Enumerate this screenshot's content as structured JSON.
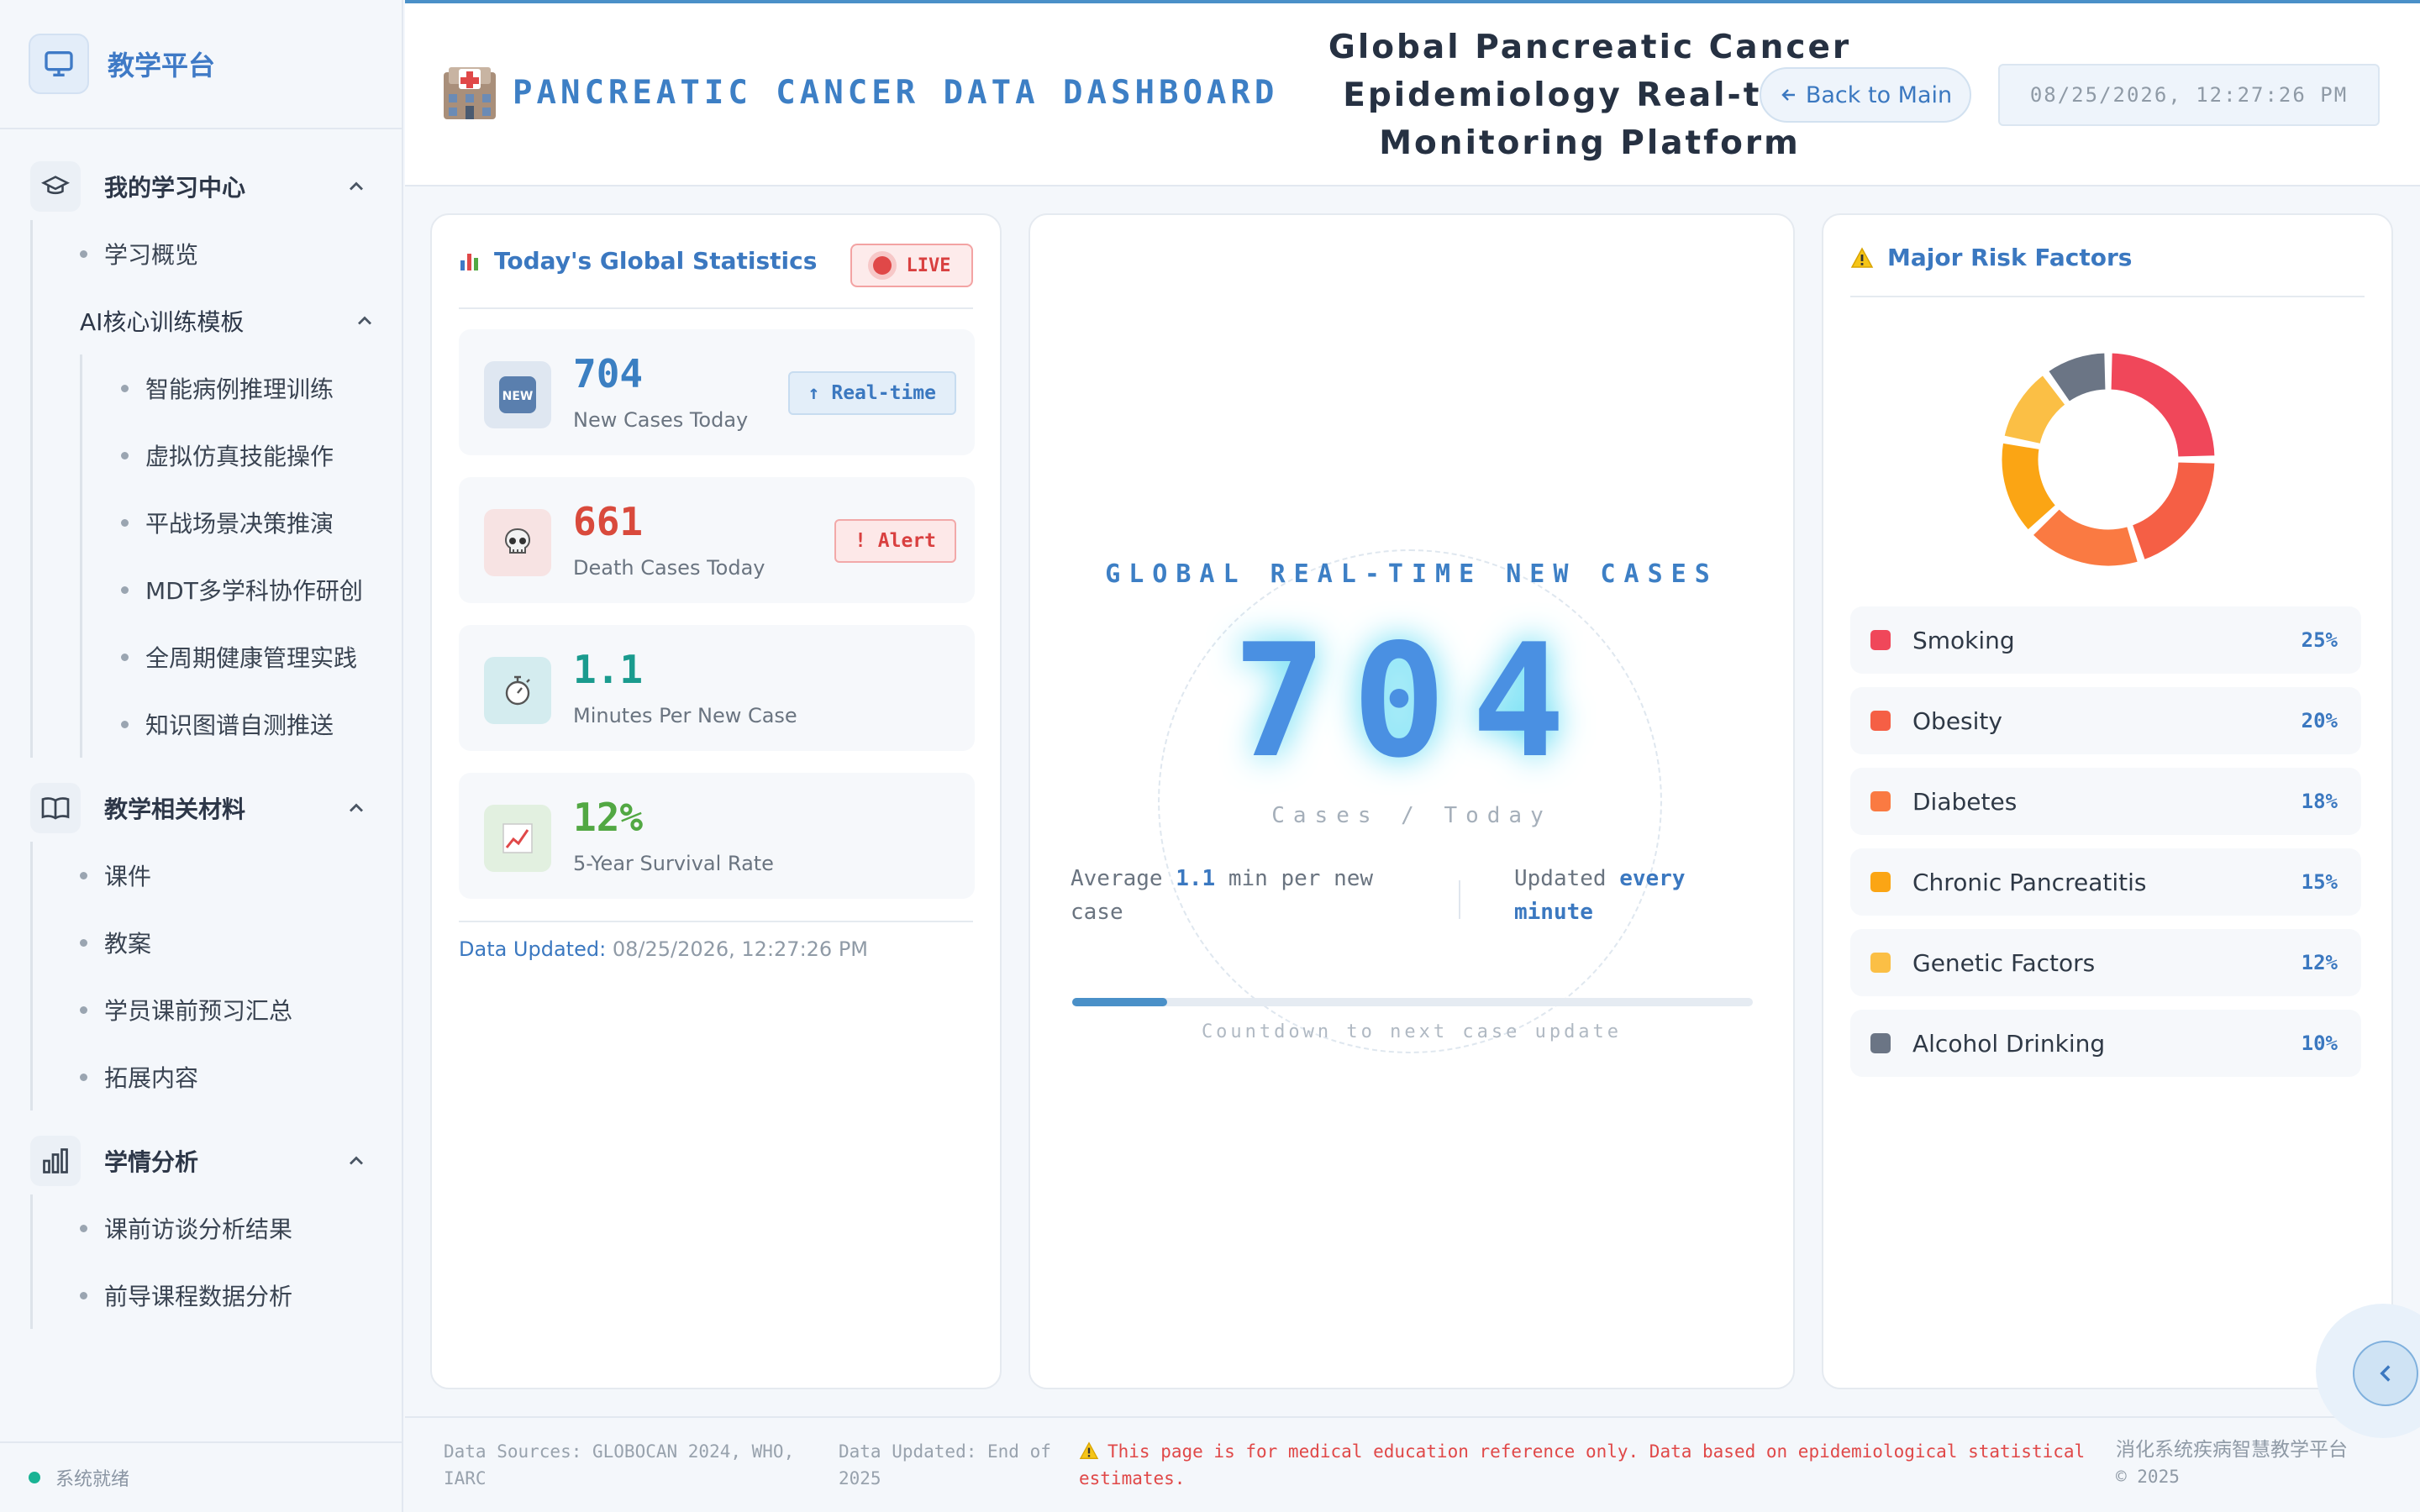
{
  "brand": {
    "name": "教学平台"
  },
  "sidebar": {
    "groups": [
      {
        "label": "我的学习中心",
        "icon": "graduation-cap-icon"
      },
      {
        "label": "教学相关材料",
        "icon": "book-icon"
      },
      {
        "label": "学情分析",
        "icon": "bar-chart-icon"
      }
    ],
    "learning_center": {
      "overview": "学习概览",
      "ai_templates": {
        "label": "AI核心训练模板",
        "items": [
          "智能病例推理训练",
          "虚拟仿真技能操作",
          "平战场景决策推演",
          "MDT多学科协作研创",
          "全周期健康管理实践",
          "知识图谱自测推送"
        ]
      }
    },
    "materials": [
      "课件",
      "教案",
      "学员课前预习汇总",
      "拓展内容"
    ],
    "analysis": [
      "课前访谈分析结果",
      "前导课程数据分析"
    ],
    "status": "系统就绪"
  },
  "header": {
    "title": "PANCREATIC CANCER DATA DASHBOARD",
    "subtitle_lines": [
      "Global Pancreatic Cancer",
      "Epidemiology Real-time",
      "Monitoring Platform"
    ],
    "back_button": "Back to Main",
    "datetime": "08/25/2026, 12:27:26 PM"
  },
  "stats_card": {
    "title": "Today's Global Statistics",
    "live": "LIVE",
    "items": [
      {
        "value": "704",
        "label": "New Cases Today",
        "badge": "↑ Real-time",
        "icon": "new-badge-icon",
        "color": "#3b7fc2"
      },
      {
        "value": "661",
        "label": "Death Cases Today",
        "badge": "! Alert",
        "icon": "skull-icon",
        "color": "#d94a3c"
      },
      {
        "value": "1.1",
        "label": "Minutes Per New Case",
        "badge": "",
        "icon": "stopwatch-icon",
        "color": "#1a9b8e"
      },
      {
        "value": "12%",
        "label": "5-Year Survival Rate",
        "badge": "",
        "icon": "chart-up-icon",
        "color": "#52a843"
      }
    ],
    "updated_label": "Data Updated:",
    "updated_value": "08/25/2026, 12:27:26 PM"
  },
  "center": {
    "title": "GLOBAL REAL-TIME NEW CASES",
    "value": "704",
    "unit": "Cases / Today",
    "avg_prefix": "Average",
    "avg_value": "1.1",
    "avg_suffix": "min per new case",
    "upd_prefix": "Updated",
    "upd_value": "every minute",
    "progress": 0.14,
    "countdown": "Countdown to next case update"
  },
  "risk_card": {
    "title": "Major Risk Factors",
    "colors": [
      "#f0475a",
      "#f55f45",
      "#fa7a42",
      "#fba514",
      "#fbbf45",
      "#6b7585"
    ]
  },
  "chart_data": {
    "type": "pie",
    "categories": [
      "Smoking",
      "Obesity",
      "Diabetes",
      "Chronic Pancreatitis",
      "Genetic Factors",
      "Alcohol Drinking"
    ],
    "values": [
      25,
      20,
      18,
      15,
      12,
      10
    ],
    "labels": [
      "25%",
      "20%",
      "18%",
      "15%",
      "12%",
      "10%"
    ]
  },
  "footer": {
    "sources": "Data Sources: GLOBOCAN 2024, WHO, IARC",
    "updated": "Data Updated: End of 2025",
    "warning": "This page is for medical education reference only. Data based on epidemiological statistical estimates.",
    "org": "消化系统疾病智慧教学平台",
    "copyright": "© 2025"
  }
}
